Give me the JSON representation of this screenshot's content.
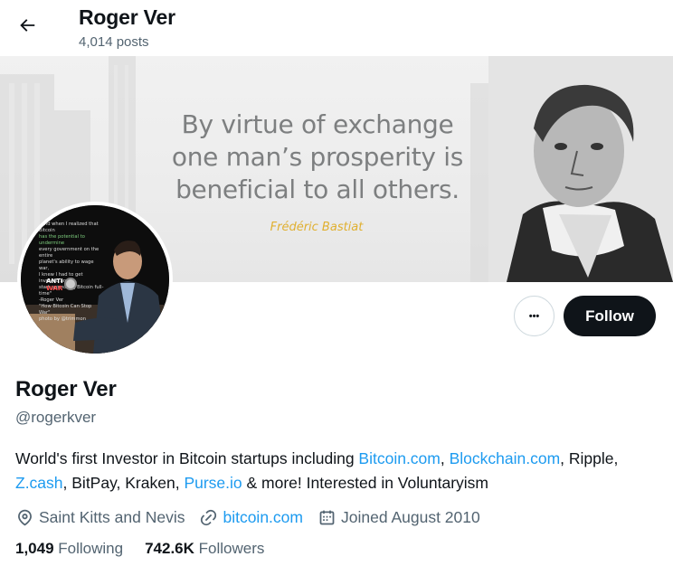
{
  "header": {
    "name": "Roger Ver",
    "posts": "4,014 posts"
  },
  "banner": {
    "quote_line1": "By virtue of exchange",
    "quote_line2": "one man’s prosperity is",
    "quote_line3": "beneficial to all others.",
    "quote_author": "Frédéric Bastiat"
  },
  "avatar": {
    "caption_lines": [
      "\"And when I realized that Bitcoin",
      "has the potential to undermine",
      "every government on the entire",
      "planet's ability to wage war,",
      "I knew I had to get involved and",
      "start promoting Bitcoin full-time\"",
      "-Roger Ver",
      "\"How Bitcoin Can Stop War\"",
      "photo by @trimmon"
    ],
    "badge_line1": "ANTI",
    "badge_line2": "WAR"
  },
  "actions": {
    "more_glyph": "•••",
    "follow_label": "Follow"
  },
  "profile": {
    "name": "Roger Ver",
    "handle": "@rogerkver",
    "bio": {
      "t1": "World's first Investor in Bitcoin startups including ",
      "l1": "Bitcoin.com",
      "t2": ", ",
      "l2": "Blockchain.com",
      "t3": ", Ripple, ",
      "l3": "Z.cash",
      "t4": ", BitPay, Kraken, ",
      "l4": "Purse.io",
      "t5": " & more! Interested in Voluntaryism"
    },
    "location": "Saint Kitts and Nevis",
    "website": "bitcoin.com",
    "joined": "Joined August 2010",
    "following_count": "1,049",
    "following_label": "Following",
    "followers_count": "742.6K",
    "followers_label": "Followers"
  },
  "colors": {
    "accent": "#1d9bf0",
    "text": "#0f1419",
    "muted": "#536471",
    "quote_author": "#e0b030"
  },
  "icons": [
    "back-arrow-icon",
    "more-icon",
    "location-pin-icon",
    "link-icon",
    "calendar-icon"
  ]
}
